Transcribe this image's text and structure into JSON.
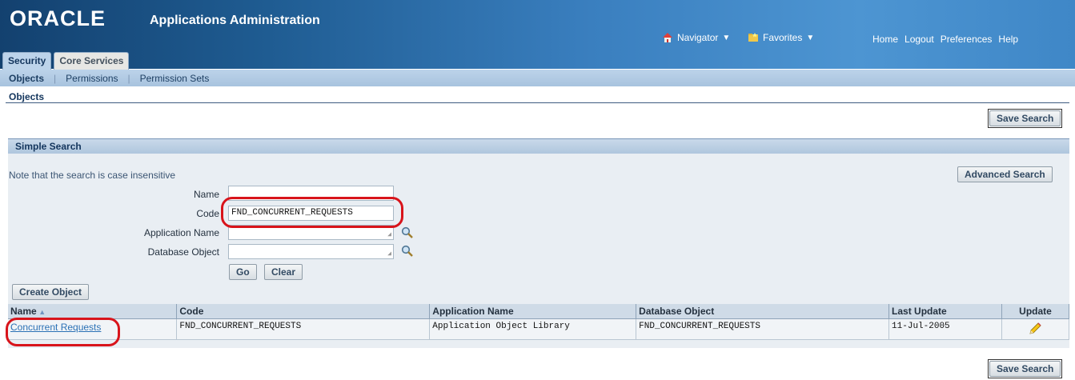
{
  "header": {
    "logo": "ORACLE",
    "app_title": "Applications Administration",
    "navigator": "Navigator",
    "favorites": "Favorites",
    "links": [
      "Home",
      "Logout",
      "Preferences",
      "Help"
    ]
  },
  "tabs": [
    {
      "label": "Security",
      "active": true
    },
    {
      "label": "Core Services",
      "active": false
    }
  ],
  "subnav": [
    "Objects",
    "Permissions",
    "Permission Sets"
  ],
  "page_title": "Objects",
  "save_search_label": "Save Search",
  "simple_search": {
    "title": "Simple Search",
    "note": "Note that the search is case insensitive",
    "advanced_label": "Advanced Search",
    "fields": {
      "name": {
        "label": "Name",
        "value": ""
      },
      "code": {
        "label": "Code",
        "value": "FND_CONCURRENT_REQUESTS"
      },
      "app_name": {
        "label": "Application Name",
        "value": ""
      },
      "db_object": {
        "label": "Database Object",
        "value": ""
      }
    },
    "go_label": "Go",
    "clear_label": "Clear",
    "create_label": "Create Object"
  },
  "results": {
    "columns": [
      "Name",
      "Code",
      "Application Name",
      "Database Object",
      "Last Update",
      "Update"
    ],
    "rows": [
      {
        "name": "Concurrent Requests",
        "code": "FND_CONCURRENT_REQUESTS",
        "app_name": "Application Object Library",
        "db_object": "FND_CONCURRENT_REQUESTS",
        "last_update": "11-Jul-2005"
      }
    ]
  },
  "colors": {
    "highlight": "#d8141b",
    "header_dark": "#13416f",
    "link": "#2b71b5"
  }
}
